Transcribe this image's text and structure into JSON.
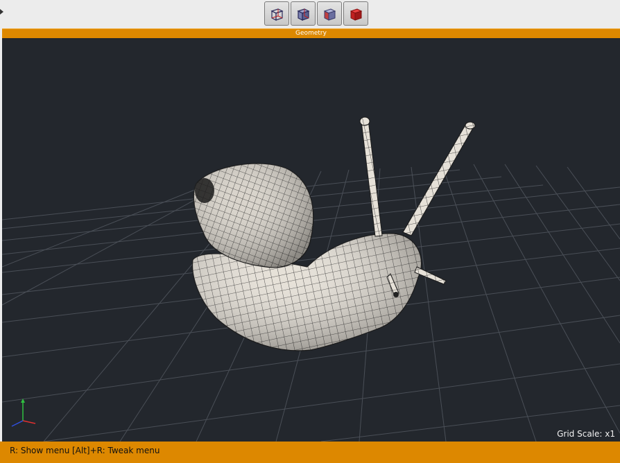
{
  "toolbar": {
    "buttons": [
      {
        "name": "wireframe-cube-view-button"
      },
      {
        "name": "shaded-wire-cube-view-button"
      },
      {
        "name": "smooth-shaded-cube-view-button"
      },
      {
        "name": "solid-red-cube-view-button"
      }
    ]
  },
  "panel": {
    "title": "Geometry"
  },
  "viewport": {
    "grid_scale_label": "Grid Scale: x1"
  },
  "status": {
    "show_menu": "R: Show menu",
    "tweak_menu": "[Alt]+R: Tweak menu"
  },
  "colors": {
    "accent": "#dd8800",
    "viewport_bg": "#23272d",
    "grid": "#4a4f57",
    "mesh": "#e6e0d6"
  }
}
